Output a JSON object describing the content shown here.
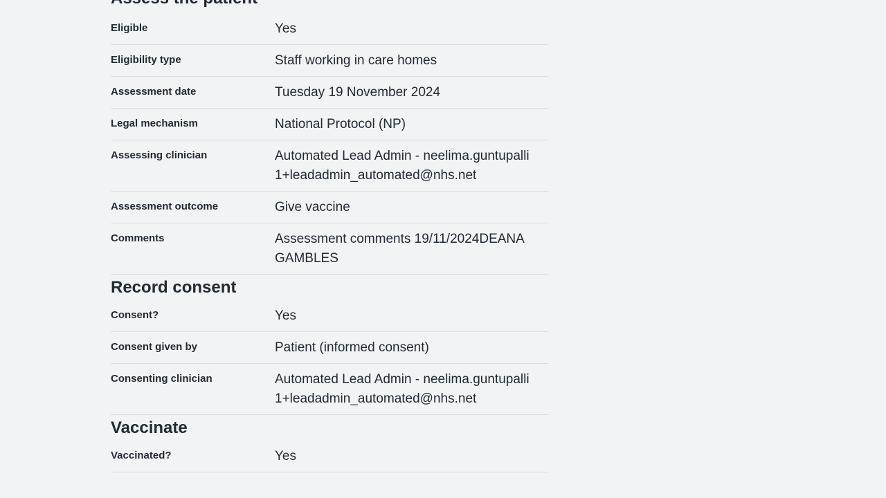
{
  "sections": [
    {
      "title": "Assess the patient",
      "rows": [
        {
          "key": "Eligible",
          "value": "Yes"
        },
        {
          "key": "Eligibility type",
          "value": "Staff working in care homes"
        },
        {
          "key": "Assessment date",
          "value": "Tuesday 19 November 2024"
        },
        {
          "key": "Legal mechanism",
          "value": "National Protocol (NP)"
        },
        {
          "key": "Assessing clinician",
          "value": "Automated Lead Admin - neelima.guntupalli1+leadadmin_automated@nhs.net"
        },
        {
          "key": "Assessment outcome",
          "value": "Give vaccine"
        },
        {
          "key": "Comments",
          "value": "Assessment comments 19/11/2024DEANA GAMBLES"
        }
      ]
    },
    {
      "title": "Record consent",
      "rows": [
        {
          "key": "Consent?",
          "value": "Yes"
        },
        {
          "key": "Consent given by",
          "value": "Patient (informed consent)"
        },
        {
          "key": "Consenting clinician",
          "value": "Automated Lead Admin - neelima.guntupalli1+leadadmin_automated@nhs.net"
        }
      ]
    },
    {
      "title": "Vaccinate",
      "rows": [
        {
          "key": "Vaccinated?",
          "value": "Yes"
        }
      ]
    }
  ]
}
